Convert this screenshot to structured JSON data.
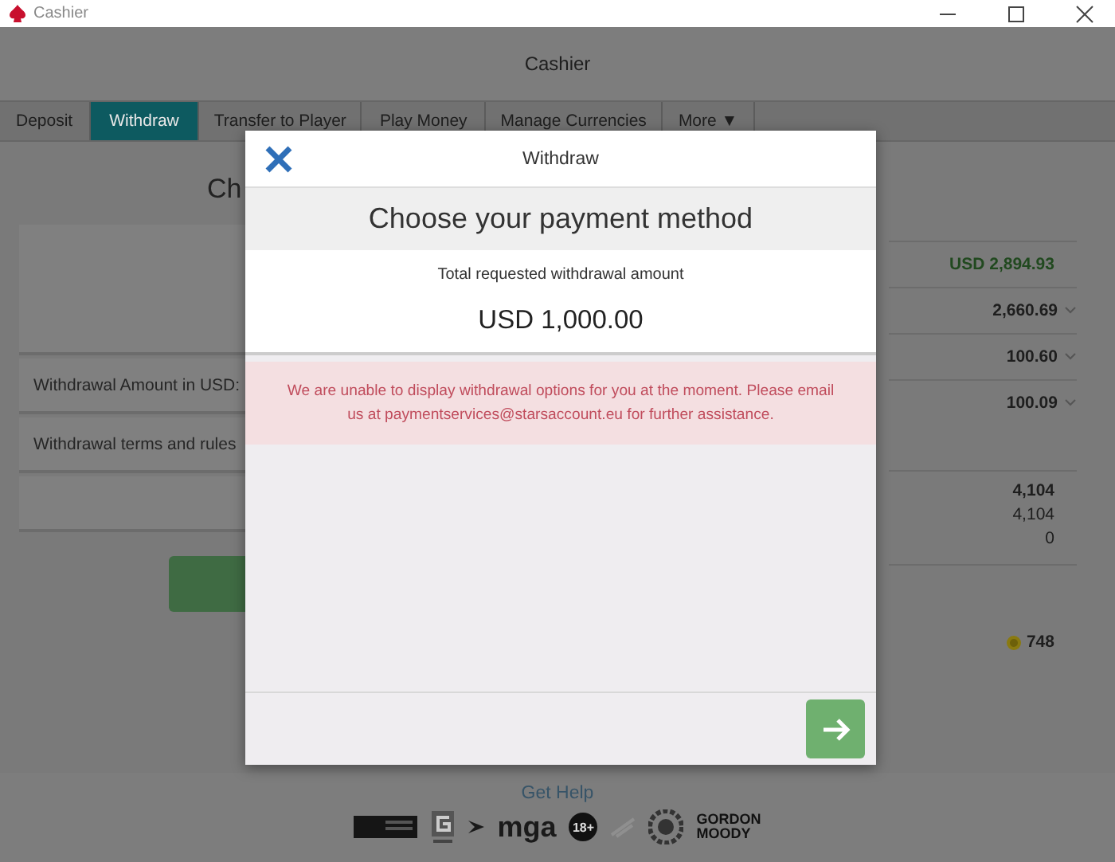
{
  "window": {
    "title": "Cashier"
  },
  "header": {
    "title": "Cashier"
  },
  "tabs": [
    {
      "label": "Deposit",
      "selected": false
    },
    {
      "label": "Withdraw",
      "selected": true
    },
    {
      "label": "Transfer to Player",
      "selected": false
    },
    {
      "label": "Play Money",
      "selected": false
    },
    {
      "label": "Manage Currencies",
      "selected": false
    },
    {
      "label": "More ▼",
      "selected": false
    }
  ],
  "form": {
    "heading": "Ch",
    "fields": [
      "Withdrawal Amount in USD:",
      "Withdrawal terms and rules"
    ]
  },
  "balances": {
    "total": "USD 2,894.93",
    "rows": [
      "2,660.69",
      "100.60",
      "100.09"
    ],
    "points": [
      "4,104",
      "4,104",
      "0"
    ],
    "coins": "748"
  },
  "modal": {
    "title": "Withdraw",
    "heading": "Choose your payment method",
    "amount_label": "Total requested withdrawal amount",
    "amount": "USD 1,000.00",
    "error": "We are unable to display withdrawal options for you at the moment. Please email us at paymentservices@starsaccount.eu for further assistance."
  },
  "footer": {
    "help": "Get Help",
    "logos": {
      "mga": "mga",
      "age": "18+",
      "charity": [
        "GORDON",
        "MOODY"
      ]
    }
  }
}
